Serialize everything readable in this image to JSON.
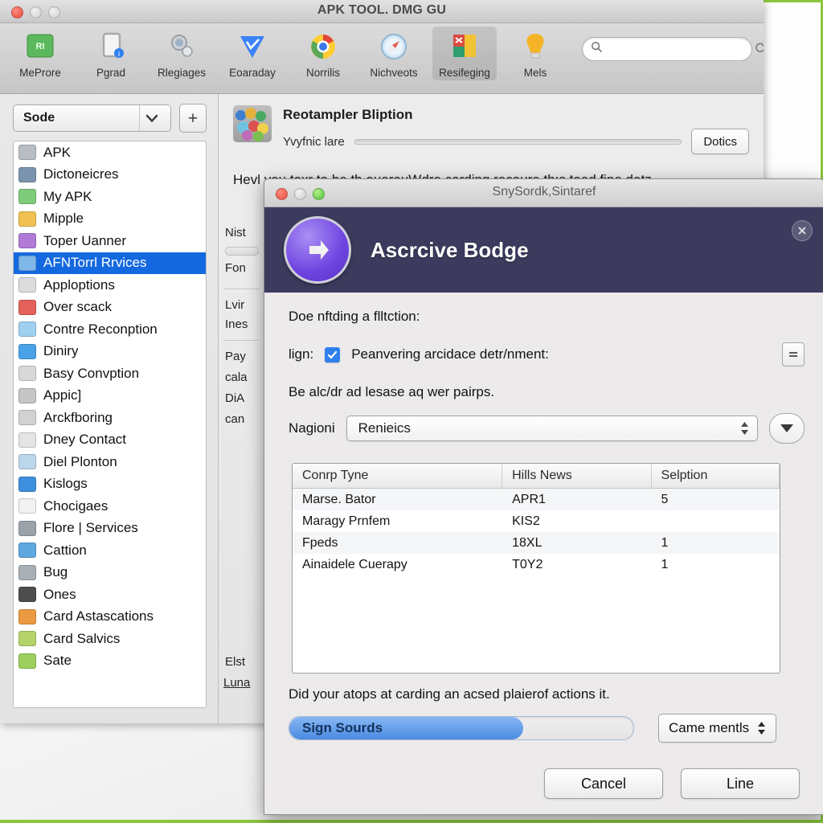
{
  "window": {
    "title": "APK TOOL. DMG GU",
    "traffic_lights": [
      "close",
      "minimize",
      "zoom"
    ]
  },
  "toolbar": {
    "items": [
      {
        "label": "MeProre",
        "icon": "green-app-icon",
        "active": false
      },
      {
        "label": "Pgrad",
        "icon": "device-upgrade-icon",
        "active": false
      },
      {
        "label": "Rlegiages",
        "icon": "magnifier-icon",
        "active": false
      },
      {
        "label": "Eoaraday",
        "icon": "blue-check-diamond-icon",
        "active": false
      },
      {
        "label": "Norrilis",
        "icon": "chrome-browser-icon",
        "active": false
      },
      {
        "label": "Nichveots",
        "icon": "safari-compass-icon",
        "active": false
      },
      {
        "label": "Resifeging",
        "icon": "colored-blocks-icon",
        "active": true
      },
      {
        "label": "Mels",
        "icon": "lightbulb-icon",
        "active": false
      }
    ],
    "search": {
      "placeholder": "",
      "value": "",
      "icon": "search-icon",
      "refresh_icon": "refresh-icon"
    }
  },
  "sidebar": {
    "source": {
      "value": "Sode",
      "chevron_icon": "chevron-down-icon"
    },
    "add_label": "+",
    "items": [
      {
        "label": "APK",
        "icon": "photo-tile-icon",
        "color": "#b9bec4",
        "selected": false
      },
      {
        "label": "Dictoneicres",
        "icon": "contacts-icon",
        "color": "#7c93ae",
        "selected": false
      },
      {
        "label": "My APK",
        "icon": "green-window-icon",
        "color": "#7ecb7a",
        "selected": false
      },
      {
        "label": "Mipple",
        "icon": "paint-swirl-icon",
        "color": "#f0c050",
        "selected": false
      },
      {
        "label": "Toper Uanner",
        "icon": "purple-sphere-icon",
        "color": "#b07ad6",
        "selected": false
      },
      {
        "label": "AFNTorrl Rrvices",
        "icon": "blue-folder-icon",
        "color": "#7fb7e8",
        "selected": true
      },
      {
        "label": "Apploptions",
        "icon": "calendar-icon",
        "color": "#dcdcdc",
        "selected": false
      },
      {
        "label": "Over scack",
        "icon": "red-flower-icon",
        "color": "#e2615a",
        "selected": false
      },
      {
        "label": "Contre Reconption",
        "icon": "blue-doc-icon",
        "color": "#9fd0f0",
        "selected": false
      },
      {
        "label": "Diniry",
        "icon": "download-arrow-icon",
        "color": "#4aa3e8",
        "selected": false
      },
      {
        "label": "Basy Convption",
        "icon": "grey-leaf-icon",
        "color": "#d8d8d8",
        "selected": false
      },
      {
        "label": "Appic]",
        "icon": "window-preview-icon",
        "color": "#c6c6c6",
        "selected": false
      },
      {
        "label": "Arckfboring",
        "icon": "grey-panel-icon",
        "color": "#d2d2d2",
        "selected": false
      },
      {
        "label": "Dney Contact",
        "icon": "list-card-icon",
        "color": "#e4e4e4",
        "selected": false
      },
      {
        "label": "Diel Plonton",
        "icon": "landscape-photo-icon",
        "color": "#bcd6ea",
        "selected": false
      },
      {
        "label": "Kislogs",
        "icon": "blue-folder-icon",
        "color": "#3e8fdd",
        "selected": false
      },
      {
        "label": "Chocigaes",
        "icon": "document-icon",
        "color": "#f2f2f2",
        "selected": false
      },
      {
        "label": "Flore | Services",
        "icon": "grey-window-icon",
        "color": "#9aa3aa",
        "selected": false
      },
      {
        "label": "Cattion",
        "icon": "chart-bars-icon",
        "color": "#5fa8e0",
        "selected": false
      },
      {
        "label": "Bug",
        "icon": "grey-bag-icon",
        "color": "#a8b0b6",
        "selected": false
      },
      {
        "label": "Ones",
        "icon": "dark-tile-icon",
        "color": "#4d4d4d",
        "selected": false
      },
      {
        "label": "Card Astascations",
        "icon": "orange-card-icon",
        "color": "#eb9a42",
        "selected": false
      },
      {
        "label": "Card Salvics",
        "icon": "people-icon",
        "color": "#b5d36b",
        "selected": false
      },
      {
        "label": "Sate",
        "icon": "plant-icon",
        "color": "#9dcf5e",
        "selected": false
      }
    ]
  },
  "content": {
    "app_icon": "colored-balls-icon",
    "title": "Reotampler Bliption",
    "sub_label": "Yvyfnic lare",
    "action_button": "Dotics",
    "paragraph": "Hevl you toxr to be th ouerouWdre carding recaure thıs tood fine detz",
    "occluded_labels": [
      "Nist",
      "Fon",
      "Lvir",
      "Ines",
      "Pay",
      "cala",
      "DiA",
      "can",
      "Elst",
      "Luna"
    ]
  },
  "dialog": {
    "titlebar_text": "SnySordk,Sintaref",
    "banner_title": "Ascrcive Bodge",
    "banner_icon": "purple-arrow-circle-icon",
    "close_icon": "close-x-icon",
    "banner_color": "#3c3b5e",
    "instruction": "Doe nftding a flltction:",
    "check_row": {
      "prefix": "lign:",
      "checkbox_checked": true,
      "label": "Peanvering arcidace detr/nment:",
      "side_button_icon": "list-lines-icon"
    },
    "note": "Be alc/dr ad lesase aq wer pairps.",
    "select_row": {
      "label": "Nagioni",
      "value": "Renieics",
      "stepper_icon": "up-down-arrows-icon",
      "menu_button_icon": "triangle-down-icon"
    },
    "table": {
      "columns": [
        "Conrp Tyne",
        "Hills News",
        "Selption"
      ],
      "rows": [
        [
          "Marse. Bator",
          "APR1",
          "5"
        ],
        [
          "Maragy Prnfem",
          "KIS2",
          ""
        ],
        [
          "Fpeds",
          "18XL",
          "1"
        ],
        [
          "Ainaidele Cuerapy",
          "T0Y2",
          "1"
        ]
      ]
    },
    "footer_note": "Did your atops at carding an acsed plaierof actions it.",
    "progress": {
      "label": "Sign Sourds",
      "percent": 68
    },
    "stepper": {
      "value": "Came mentls",
      "icon": "up-down-arrows-icon"
    },
    "buttons": {
      "cancel": "Cancel",
      "confirm": "Line"
    }
  },
  "colors": {
    "selection_blue": "#1569e0",
    "banner_navy": "#3c3b5e",
    "accent_purple": "#6f43e0",
    "progress_blue": "#4a8ae0",
    "desktop_edge_green": "#8cc63f"
  }
}
